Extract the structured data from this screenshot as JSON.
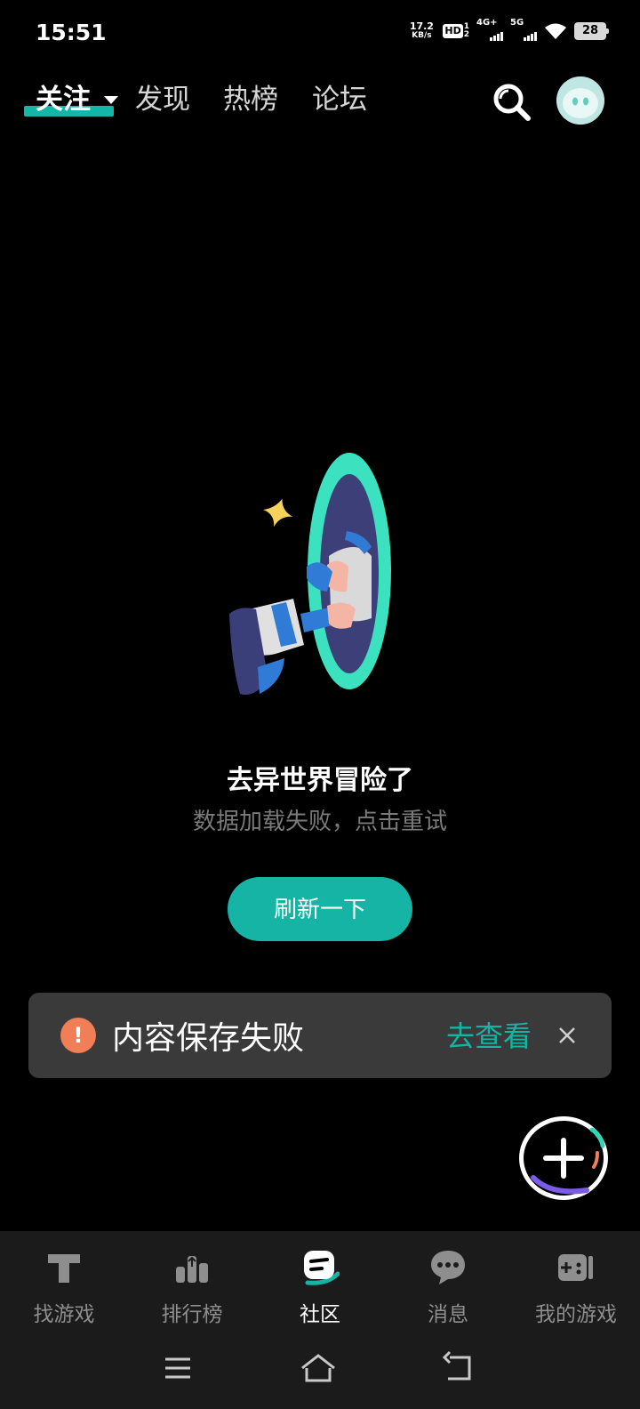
{
  "status_bar": {
    "time": "15:51",
    "net_speed_value": "17.2",
    "net_speed_unit": "KB/s",
    "hd_label": "HD",
    "hd_sub_top": "1",
    "hd_sub_bottom": "2",
    "signal_1_label": "4G+",
    "signal_2_label": "5G",
    "battery": "28"
  },
  "top_nav": {
    "tabs": [
      {
        "label": "关注"
      },
      {
        "label": "发现"
      },
      {
        "label": "热榜"
      },
      {
        "label": "论坛"
      }
    ],
    "search_icon": "search-icon",
    "avatar_icon": "avatar"
  },
  "empty_state": {
    "title": "去异世界冒险了",
    "subtitle": "数据加载失败，点击重试",
    "refresh_label": "刷新一下"
  },
  "toast": {
    "icon": "warning-icon",
    "message": "内容保存失败",
    "link_label": "去查看",
    "close_icon": "close-icon"
  },
  "fab": {
    "icon": "plus-icon"
  },
  "bottom_nav": {
    "items": [
      {
        "label": "找游戏",
        "icon": "find-game-icon"
      },
      {
        "label": "排行榜",
        "icon": "ranking-icon"
      },
      {
        "label": "社区",
        "icon": "community-icon"
      },
      {
        "label": "消息",
        "icon": "message-icon"
      },
      {
        "label": "我的游戏",
        "icon": "my-games-icon"
      }
    ]
  },
  "colors": {
    "accent": "#15b4a5",
    "warning": "#f07f57",
    "toast_bg": "#3a3a3a",
    "nav_bg": "#1b1b1b"
  }
}
